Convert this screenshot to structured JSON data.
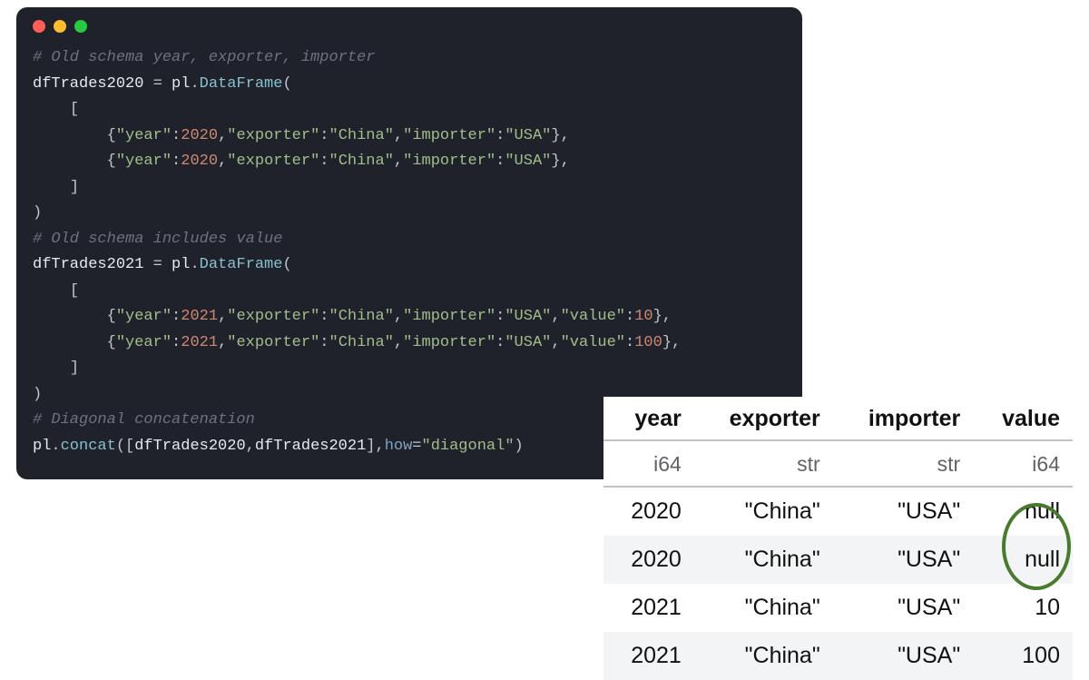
{
  "code": {
    "comment1": "# Old schema year, exporter, importer",
    "assign1_lhs": "dfTrades2020",
    "eq": " = ",
    "pl": "pl",
    "dot": ".",
    "DataFrame": "DataFrame",
    "op_paren": "(",
    "cl_paren": ")",
    "op_brack": "[",
    "cl_brack": "]",
    "indent1": "    ",
    "indent2": "        ",
    "row1a": {
      "pre": "{",
      "k_year": "\"year\"",
      "colon": ":",
      "v_year": "2020",
      "comma": ",",
      "k_exp": "\"exporter\"",
      "v_exp": "\"China\"",
      "k_imp": "\"importer\"",
      "v_imp": "\"USA\"",
      "post": "},"
    },
    "row1b": {
      "pre": "{",
      "k_year": "\"year\"",
      "colon": ":",
      "v_year": "2020",
      "comma": ",",
      "k_exp": "\"exporter\"",
      "v_exp": "\"China\"",
      "k_imp": "\"importer\"",
      "v_imp": "\"USA\"",
      "post": "},"
    },
    "comment2": "# Old schema includes value",
    "assign2_lhs": "dfTrades2021",
    "row2a": {
      "pre": "{",
      "k_year": "\"year\"",
      "colon": ":",
      "v_year": "2021",
      "comma": ",",
      "k_exp": "\"exporter\"",
      "v_exp": "\"China\"",
      "k_imp": "\"importer\"",
      "v_imp": "\"USA\"",
      "k_val": "\"value\"",
      "v_val": "10",
      "post": "},"
    },
    "row2b": {
      "pre": "{",
      "k_year": "\"year\"",
      "colon": ":",
      "v_year": "2021",
      "comma": ",",
      "k_exp": "\"exporter\"",
      "v_exp": "\"China\"",
      "k_imp": "\"importer\"",
      "v_imp": "\"USA\"",
      "k_val": "\"value\"",
      "v_val": "100",
      "post": "},"
    },
    "comment3": "# Diagonal concatenation",
    "concat": "concat",
    "concat_args_open": "([",
    "concat_args_mid": ",",
    "concat_args_close": "],",
    "how_key": "how",
    "how_eq": "=",
    "how_val": "\"diagonal\""
  },
  "table": {
    "headers": [
      "year",
      "exporter",
      "importer",
      "value"
    ],
    "dtypes": [
      "i64",
      "str",
      "str",
      "i64"
    ],
    "rows": [
      [
        "2020",
        "\"China\"",
        "\"USA\"",
        "null"
      ],
      [
        "2020",
        "\"China\"",
        "\"USA\"",
        "null"
      ],
      [
        "2021",
        "\"China\"",
        "\"USA\"",
        "10"
      ],
      [
        "2021",
        "\"China\"",
        "\"USA\"",
        "100"
      ]
    ]
  }
}
